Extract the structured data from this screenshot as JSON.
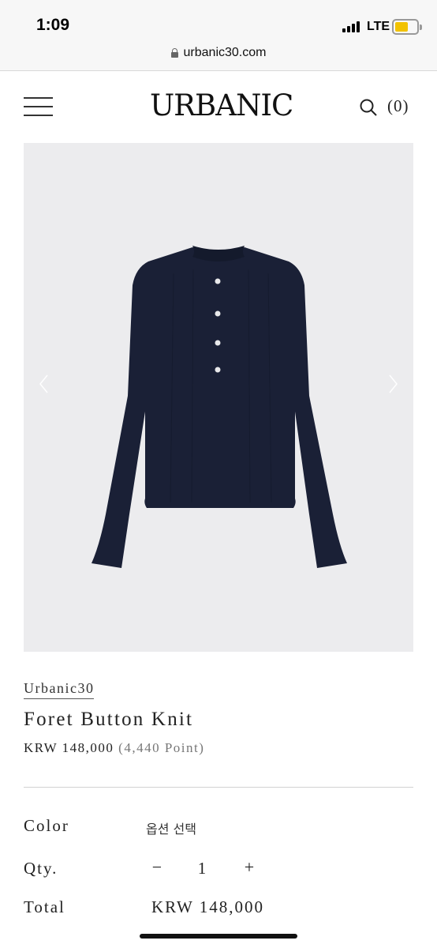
{
  "status_bar": {
    "time": "1:09",
    "network": "LTE",
    "battery_fraction": 0.6,
    "battery_color": "#f2c200"
  },
  "browser": {
    "url": "urbanic30.com",
    "lock_icon": "lock-icon"
  },
  "header": {
    "menu_icon": "hamburger-menu-icon",
    "logo": "URBANIC",
    "search_icon": "search-icon",
    "cart_count": "(0)"
  },
  "gallery": {
    "prev_icon": "chevron-left-icon",
    "next_icon": "chevron-right-icon",
    "background": "#ececee",
    "garment_color": "#1a2036"
  },
  "product": {
    "brand": "Urbanic30",
    "title": "Foret Button Knit",
    "price": "KRW 148,000",
    "points": "(4,440 Point)"
  },
  "options": {
    "color_label": "Color",
    "color_value": "옵션 선택",
    "qty_label": "Qty.",
    "qty_minus": "−",
    "qty_value": "1",
    "qty_plus": "+",
    "total_label": "Total",
    "total_value": "KRW 148,000"
  }
}
